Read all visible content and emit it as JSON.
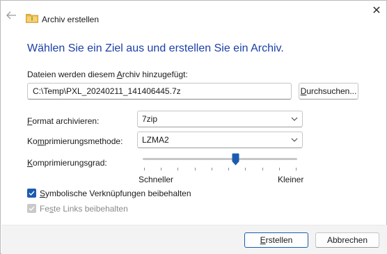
{
  "window": {
    "title": "Archiv erstellen",
    "close_glyph": "✕"
  },
  "heading": "Wählen Sie ein Ziel aus und erstellen Sie ein Archiv.",
  "files_label": {
    "before": "Dateien werden diesem ",
    "accel": "A",
    "after": "rchiv hinzugefügt:"
  },
  "archive_path": "C:\\Temp\\PXL_20240211_141406445.7z",
  "browse_button": {
    "accel": "D",
    "rest": "urchsuchen..."
  },
  "format": {
    "label_accel": "F",
    "label_rest": "ormat archivieren:",
    "value": "7zip"
  },
  "method": {
    "label_pre": "Ko",
    "label_accel": "m",
    "label_rest": "primierungsmethode:",
    "value": "LZMA2"
  },
  "level": {
    "label_accel": "K",
    "label_rest": "omprimierungsgrad:",
    "min_label": "Schneller",
    "max_label": "Kleiner",
    "value_fraction": 0.6
  },
  "checkboxes": {
    "symlinks": {
      "accel": "S",
      "rest": "ymbolische Verknüpfungen beibehalten",
      "checked": true,
      "enabled": true
    },
    "hardlinks": {
      "pre": "Fe",
      "accel": "s",
      "rest": "te Links beibehalten",
      "checked": true,
      "enabled": false
    }
  },
  "buttons": {
    "create_accel": "E",
    "create_rest": "rstellen",
    "cancel": "Abbrechen"
  },
  "colors": {
    "accent": "#1b5cb0",
    "heading": "#1b3ea8",
    "folder": "#e8b43c"
  }
}
